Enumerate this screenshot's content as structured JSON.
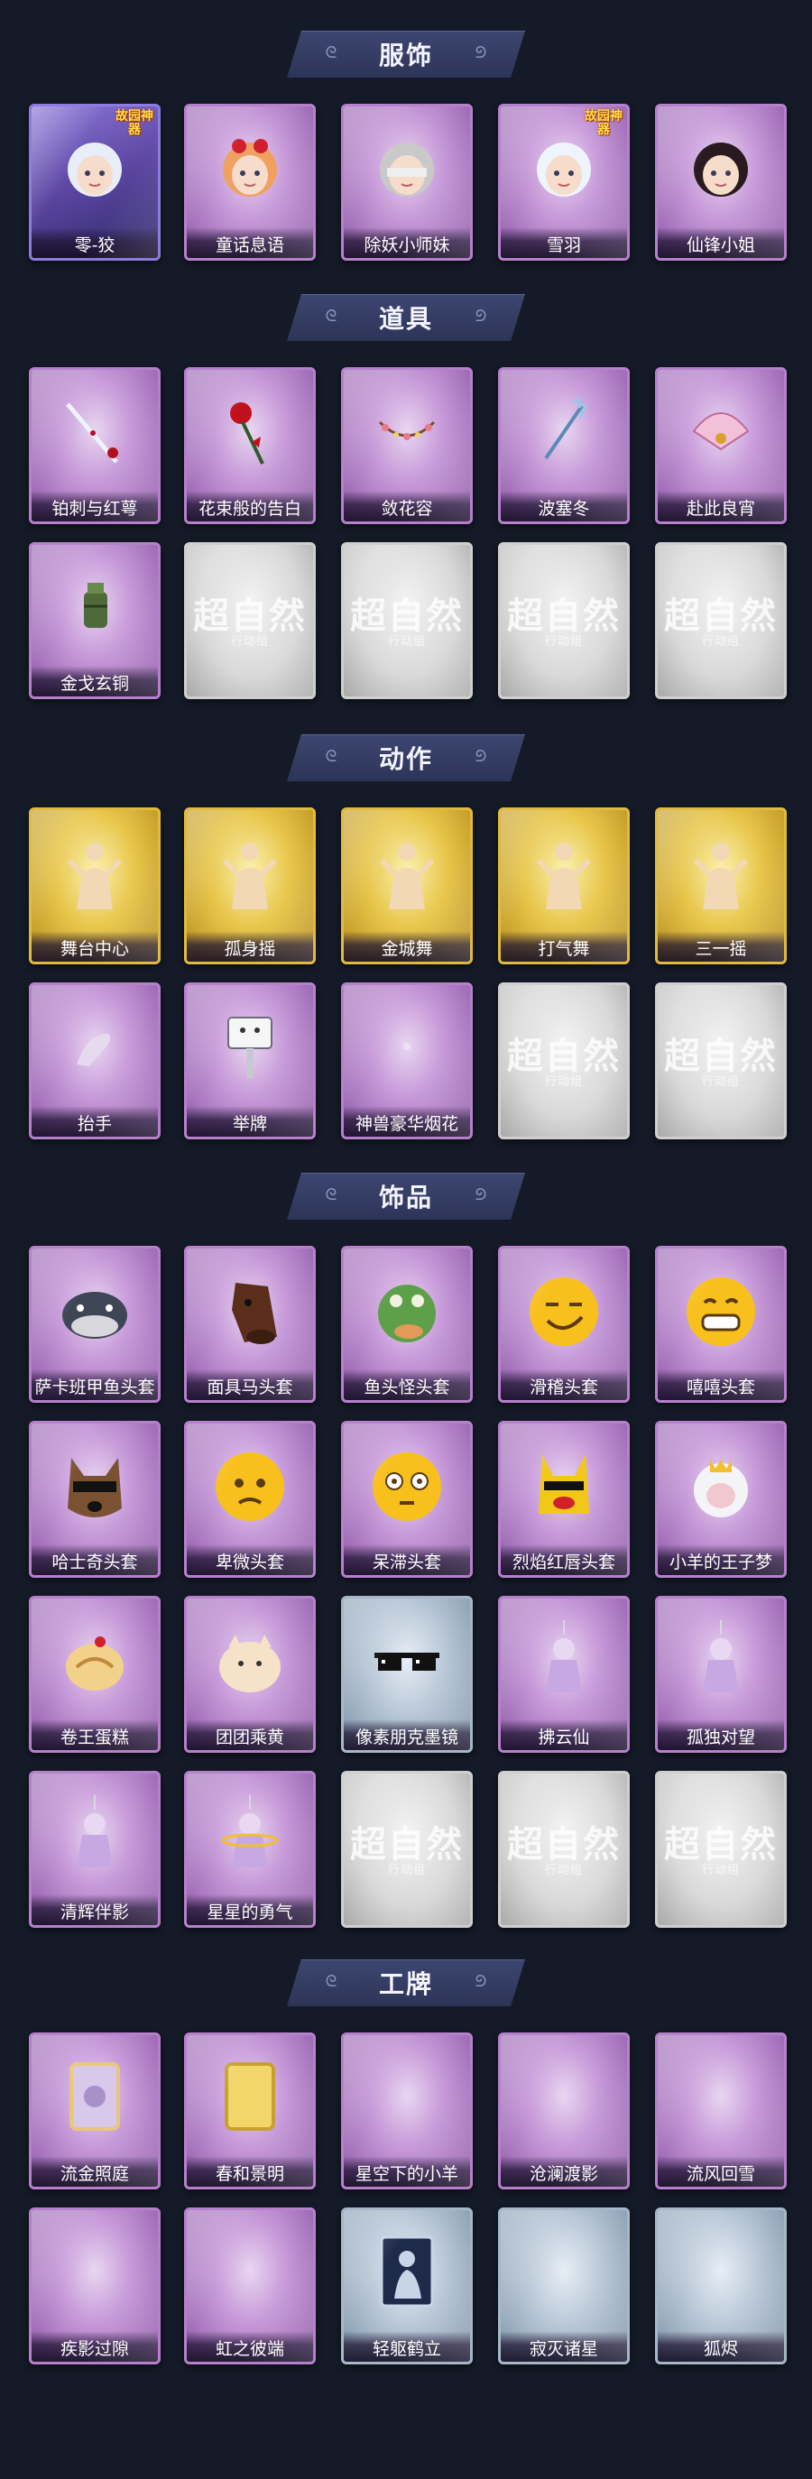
{
  "sections": [
    {
      "title": "服饰",
      "items": [
        {
          "label": "零-狡",
          "style": "special",
          "icon": "avatar-silver-hair-icon",
          "badge": "故园神器"
        },
        {
          "label": "童话息语",
          "style": "purple",
          "icon": "avatar-red-bow-icon"
        },
        {
          "label": "除妖小师妹",
          "style": "purple",
          "icon": "avatar-blindfold-icon"
        },
        {
          "label": "雪羽",
          "style": "purple",
          "icon": "avatar-white-hair-icon",
          "badge": "故园神器"
        },
        {
          "label": "仙锋小姐",
          "style": "purple",
          "icon": "avatar-dark-hair-icon"
        }
      ]
    },
    {
      "title": "道具",
      "items": [
        {
          "label": "铂刺与红萼",
          "style": "purple",
          "icon": "rose-sword-icon"
        },
        {
          "label": "花束般的告白",
          "style": "purple",
          "icon": "rose-bouquet-icon"
        },
        {
          "label": "敛花容",
          "style": "purple",
          "icon": "flower-chain-icon"
        },
        {
          "label": "波塞冬",
          "style": "purple",
          "icon": "trident-icon"
        },
        {
          "label": "赴此良宵",
          "style": "purple",
          "icon": "lantern-fan-icon"
        },
        {
          "label": "金戈玄铜",
          "style": "purple",
          "icon": "bronze-canister-icon"
        },
        {
          "label": "",
          "style": "blank",
          "icon": "locked-placeholder-icon"
        },
        {
          "label": "",
          "style": "blank",
          "icon": "locked-placeholder-icon"
        },
        {
          "label": "",
          "style": "blank",
          "icon": "locked-placeholder-icon"
        },
        {
          "label": "",
          "style": "blank",
          "icon": "locked-placeholder-icon"
        }
      ]
    },
    {
      "title": "动作",
      "items": [
        {
          "label": "舞台中心",
          "style": "gold",
          "icon": "dance-pose-icon"
        },
        {
          "label": "孤身摇",
          "style": "gold",
          "icon": "dance-pose-icon"
        },
        {
          "label": "金城舞",
          "style": "gold",
          "icon": "dance-pose-icon"
        },
        {
          "label": "打气舞",
          "style": "gold",
          "icon": "dance-pose-icon"
        },
        {
          "label": "三一摇",
          "style": "gold",
          "icon": "dance-pose-icon"
        },
        {
          "label": "抬手",
          "style": "purple",
          "icon": "raise-hand-icon"
        },
        {
          "label": "举牌",
          "style": "purple",
          "icon": "hold-sign-icon"
        },
        {
          "label": "神兽豪华烟花",
          "style": "purple",
          "icon": "fireworks-icon"
        },
        {
          "label": "",
          "style": "blank",
          "icon": "locked-placeholder-icon"
        },
        {
          "label": "",
          "style": "blank",
          "icon": "locked-placeholder-icon"
        }
      ]
    },
    {
      "title": "饰品",
      "items": [
        {
          "label": "萨卡班甲鱼头套",
          "style": "purple",
          "icon": "fish-head-icon"
        },
        {
          "label": "面具马头套",
          "style": "purple",
          "icon": "horse-mask-icon"
        },
        {
          "label": "鱼头怪头套",
          "style": "purple",
          "icon": "frog-fish-mask-icon"
        },
        {
          "label": "滑稽头套",
          "style": "purple",
          "icon": "smirk-emoji-icon"
        },
        {
          "label": "嘻嘻头套",
          "style": "purple",
          "icon": "grin-emoji-icon"
        },
        {
          "label": "哈士奇头套",
          "style": "purple",
          "icon": "husky-sunglasses-icon"
        },
        {
          "label": "卑微头套",
          "style": "purple",
          "icon": "sad-emoji-icon"
        },
        {
          "label": "呆滞头套",
          "style": "purple",
          "icon": "dazed-emoji-icon"
        },
        {
          "label": "烈焰红唇头套",
          "style": "purple",
          "icon": "pikachu-lips-icon"
        },
        {
          "label": "小羊的王子梦",
          "style": "purple",
          "icon": "sheep-crown-icon"
        },
        {
          "label": "卷王蛋糕",
          "style": "purple",
          "icon": "roll-cake-icon"
        },
        {
          "label": "团团乘黄",
          "style": "purple",
          "icon": "round-cat-icon"
        },
        {
          "label": "像素朋克墨镜",
          "style": "blue",
          "icon": "pixel-sunglasses-icon"
        },
        {
          "label": "拂云仙",
          "style": "purple",
          "icon": "fairy-charm-icon"
        },
        {
          "label": "孤独对望",
          "style": "purple",
          "icon": "doll-charm-icon"
        },
        {
          "label": "清辉伴影",
          "style": "purple",
          "icon": "moon-girl-charm-icon"
        },
        {
          "label": "星星的勇气",
          "style": "purple",
          "icon": "star-planet-charm-icon"
        },
        {
          "label": "",
          "style": "blank",
          "icon": "locked-placeholder-icon"
        },
        {
          "label": "",
          "style": "blank",
          "icon": "locked-placeholder-icon"
        },
        {
          "label": "",
          "style": "blank",
          "icon": "locked-placeholder-icon"
        }
      ]
    },
    {
      "title": "工牌",
      "items": [
        {
          "label": "流金照庭",
          "style": "purple",
          "icon": "framed-card-icon"
        },
        {
          "label": "春和景明",
          "style": "purple",
          "icon": "gold-card-icon"
        },
        {
          "label": "星空下的小羊",
          "style": "purple",
          "icon": "empty-badge-icon"
        },
        {
          "label": "沧澜渡影",
          "style": "purple",
          "icon": "empty-badge-icon"
        },
        {
          "label": "流风回雪",
          "style": "purple",
          "icon": "empty-badge-icon"
        },
        {
          "label": "疾影过隙",
          "style": "purple",
          "icon": "empty-badge-icon"
        },
        {
          "label": "虹之彼端",
          "style": "purple",
          "icon": "empty-badge-icon"
        },
        {
          "label": "轻躯鹤立",
          "style": "blue",
          "icon": "silhouette-card-icon"
        },
        {
          "label": "寂灭诸星",
          "style": "blue",
          "icon": "empty-badge-icon"
        },
        {
          "label": "狐烬",
          "style": "blue",
          "icon": "empty-badge-icon"
        }
      ]
    }
  ],
  "placeholder_watermark": "超自然",
  "placeholder_watermark_sub": "行动组",
  "colors": {
    "background": "#141a27",
    "header_plate": "#3d4670",
    "purple_tile": "#c79ad9",
    "gold_tile": "#e8c64a",
    "blue_tile": "#b7c6d6",
    "blank_tile": "#d9d9d9"
  }
}
